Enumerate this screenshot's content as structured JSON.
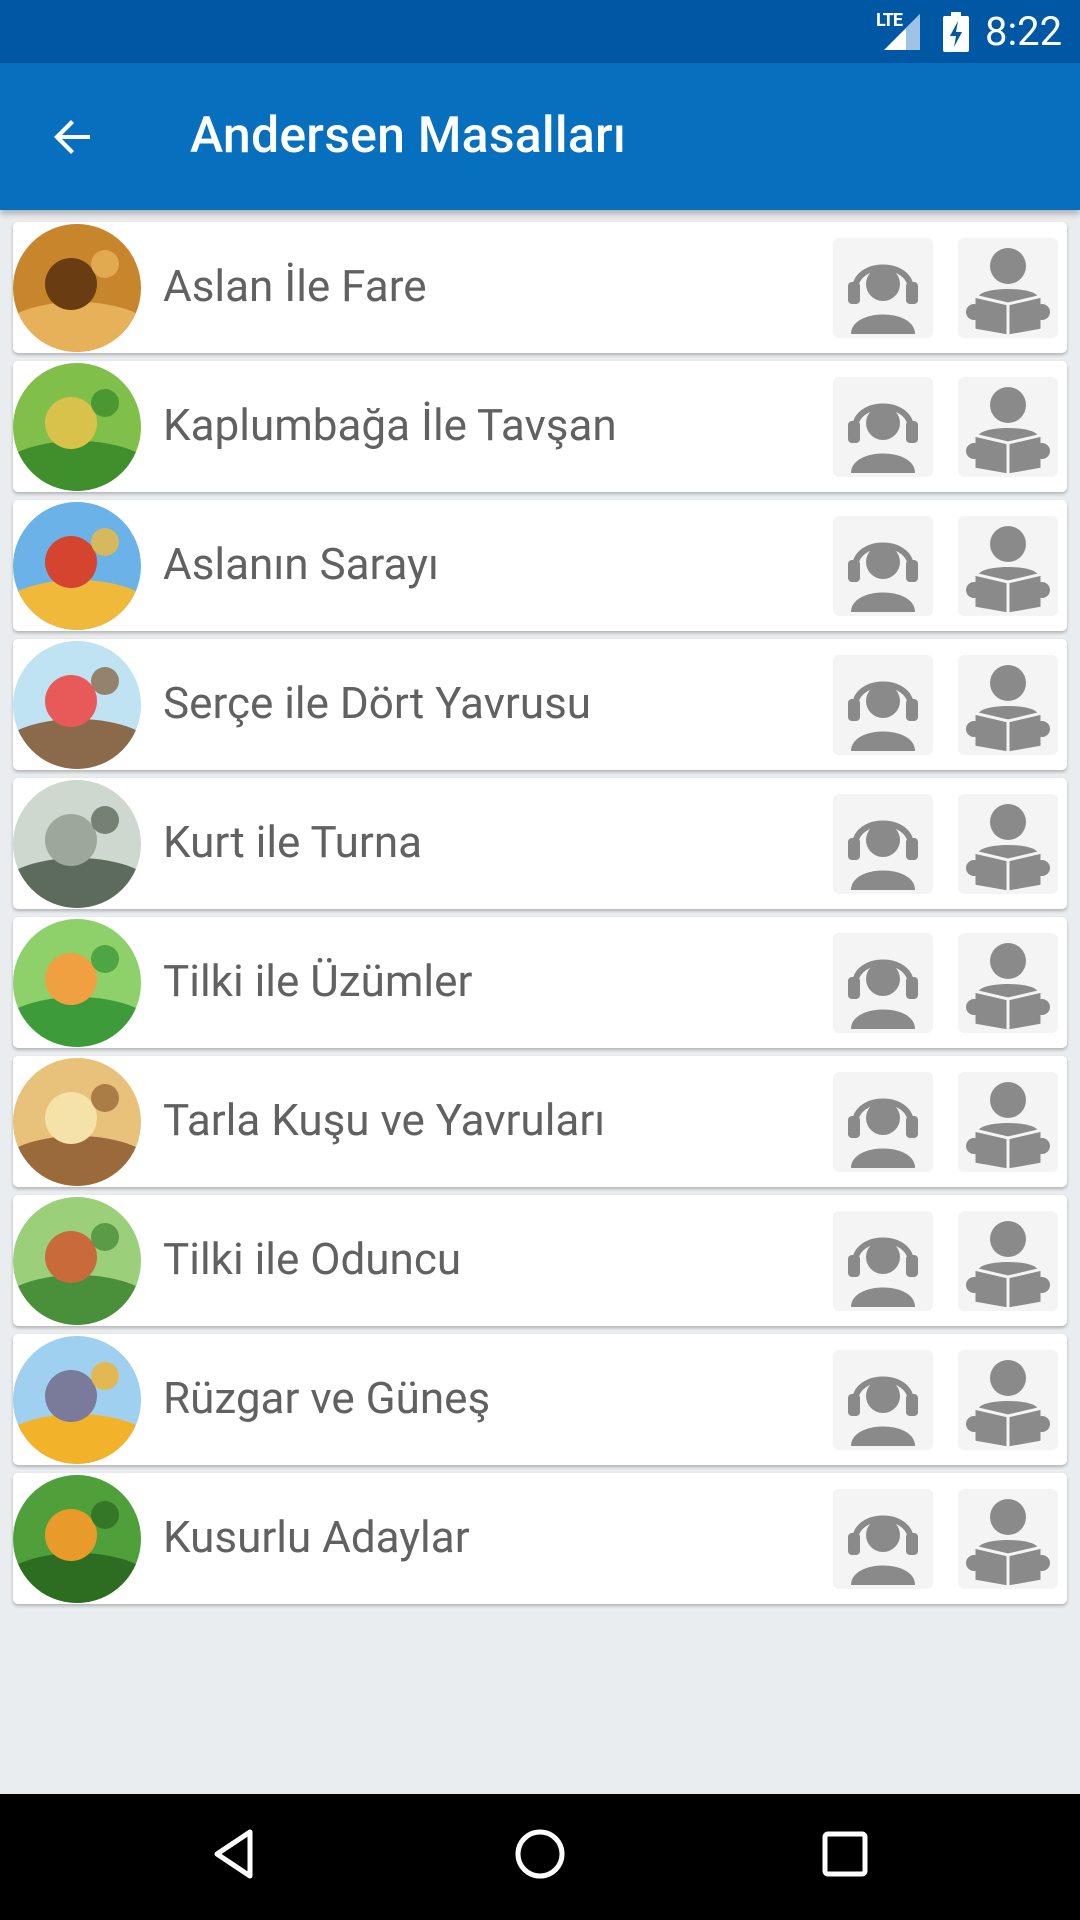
{
  "status_bar": {
    "network": "LTE",
    "time": "8:22"
  },
  "app_bar": {
    "title": "Andersen Masalları",
    "back_icon": "arrow-left-icon"
  },
  "colors": {
    "status_bar": "#0057a3",
    "app_bar": "#0670bf",
    "background": "#eaedf0",
    "icon_gray": "#8a8a8a",
    "label_text": "#616161"
  },
  "stories": [
    {
      "title": "Aslan İle Fare"
    },
    {
      "title": "Kaplumbağa İle Tavşan"
    },
    {
      "title": "Aslanın Sarayı"
    },
    {
      "title": "Serçe ile Dört Yavrusu"
    },
    {
      "title": "Kurt ile Turna"
    },
    {
      "title": "Tilki ile Üzümler"
    },
    {
      "title": "Tarla Kuşu ve Yavruları"
    },
    {
      "title": "Tilki ile Oduncu"
    },
    {
      "title": "Rüzgar ve Güneş"
    },
    {
      "title": "Kusurlu Adaylar"
    }
  ],
  "row_actions": {
    "listen_icon": "headphones-person-icon",
    "read_icon": "reading-person-icon"
  },
  "nav_bar": {
    "back": "back-triangle-icon",
    "home": "home-circle-icon",
    "recents": "recents-square-icon"
  }
}
